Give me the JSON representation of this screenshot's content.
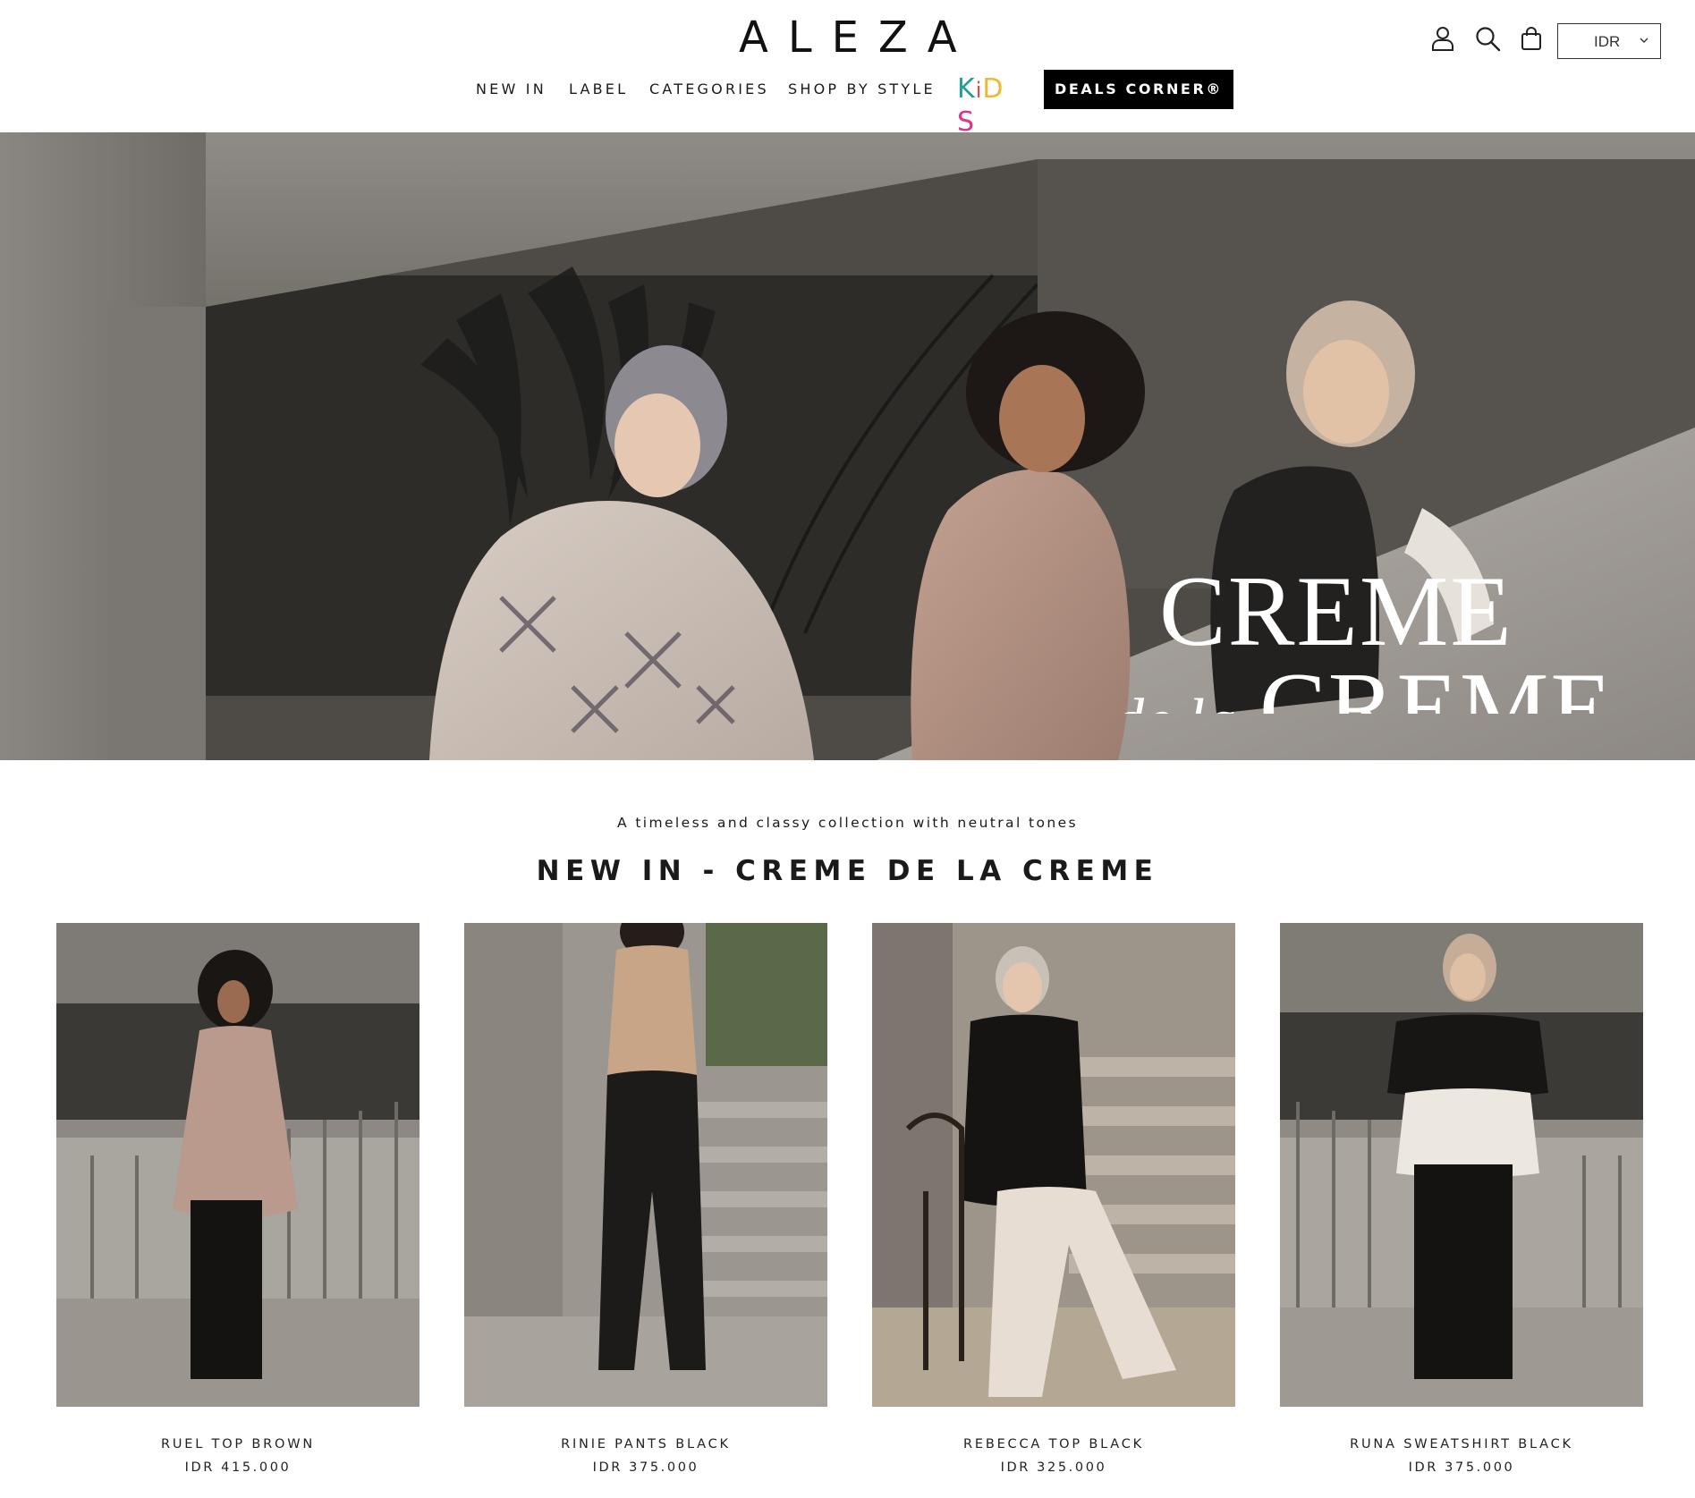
{
  "brand": {
    "logo": "ALEZA"
  },
  "nav": {
    "items": [
      "NEW IN",
      "LABEL",
      "CATEGORIES",
      "SHOP BY STYLE"
    ],
    "kids": [
      "K",
      "i",
      "D",
      "S"
    ],
    "kids_colors": [
      "#1f9e9a",
      "#e8473b",
      "#f2b632",
      "#d9368c"
    ],
    "deals": "DEALS CORNER®"
  },
  "header_icons": [
    "account-icon",
    "search-icon",
    "cart-icon"
  ],
  "currency": {
    "selected": "IDR"
  },
  "hero": {
    "title_line1": "CREME",
    "title_line2_script": "de la",
    "title_line2": "CREME"
  },
  "collection": {
    "subtitle": "A timeless and classy collection with neutral tones",
    "title": "NEW IN - CREME DE LA CREME",
    "products": [
      {
        "name": "RUEL TOP BROWN",
        "price": "IDR 415.000"
      },
      {
        "name": "RINIE PANTS BLACK",
        "price": "IDR 375.000"
      },
      {
        "name": "REBECCA TOP BLACK",
        "price": "IDR 325.000"
      },
      {
        "name": "RUNA SWEATSHIRT BLACK",
        "price": "IDR 375.000"
      }
    ]
  }
}
